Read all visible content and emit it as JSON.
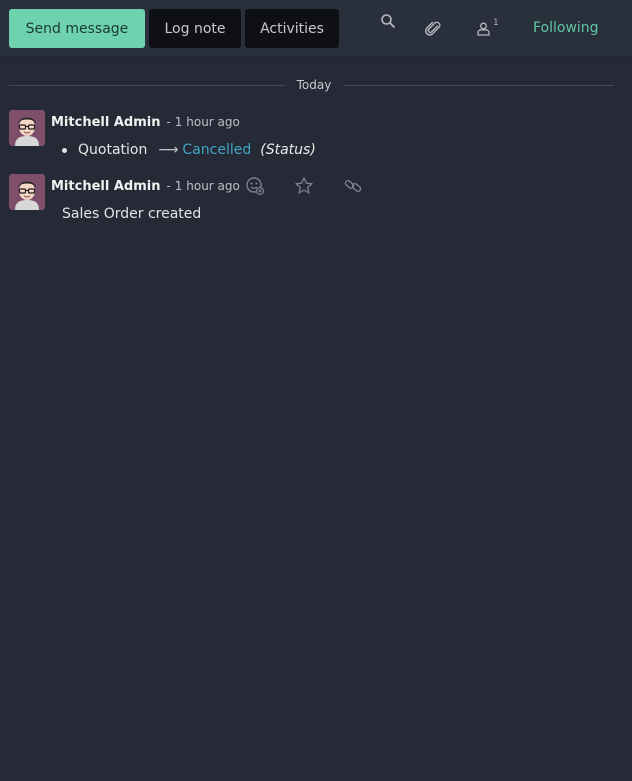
{
  "toolbar": {
    "send_label": "Send message",
    "note_label": "Log note",
    "activities_label": "Activities",
    "follower_count": "1",
    "following_label": "Following"
  },
  "thread": {
    "date_separator": "Today",
    "messages": [
      {
        "author": "Mitchell Admin",
        "separator": "-",
        "time": "1 hour ago",
        "tracking": {
          "old_value": "Quotation",
          "arrow": "⟶",
          "new_value": "Cancelled",
          "field": "(Status)"
        }
      },
      {
        "author": "Mitchell Admin",
        "separator": "-",
        "time": "1 hour ago",
        "body": "Sales Order created"
      }
    ]
  },
  "colors": {
    "background": "#262a36",
    "send_button": "#6ed2ae",
    "following": "#5fc7a2",
    "tracking_new_value": "#3fa7c4"
  },
  "icons": [
    "search-icon",
    "paperclip-icon",
    "user-icon",
    "add-reaction-icon",
    "star-icon",
    "link-icon",
    "avatar"
  ]
}
